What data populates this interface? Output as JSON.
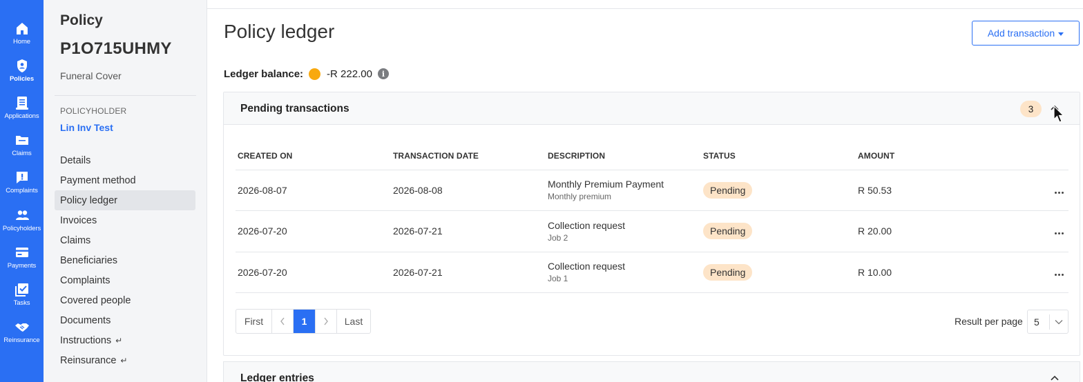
{
  "rail": [
    {
      "label": "Home",
      "icon": "home-icon"
    },
    {
      "label": "Policies",
      "icon": "shield-icon",
      "active": true
    },
    {
      "label": "Applications",
      "icon": "document-icon"
    },
    {
      "label": "Claims",
      "icon": "folder-icon"
    },
    {
      "label": "Complaints",
      "icon": "alert-message-icon"
    },
    {
      "label": "Policyholders",
      "icon": "people-icon"
    },
    {
      "label": "Payments",
      "icon": "credit-card-icon"
    },
    {
      "label": "Tasks",
      "icon": "task-check-icon"
    },
    {
      "label": "Reinsurance",
      "icon": "handshake-icon"
    }
  ],
  "policy": {
    "kicker": "Policy",
    "number": "P1O715UHMY",
    "product": "Funeral Cover",
    "policyholder_label": "POLICYHOLDER",
    "policyholder_name": "Lin Inv Test"
  },
  "nav": [
    {
      "label": "Details"
    },
    {
      "label": "Payment method"
    },
    {
      "label": "Policy ledger",
      "active": true
    },
    {
      "label": "Invoices"
    },
    {
      "label": "Claims"
    },
    {
      "label": "Beneficiaries"
    },
    {
      "label": "Complaints"
    },
    {
      "label": "Covered people"
    },
    {
      "label": "Documents"
    },
    {
      "label": "Instructions",
      "return_glyph": "↵"
    },
    {
      "label": "Reinsurance",
      "return_glyph": "↵"
    }
  ],
  "main": {
    "title": "Policy ledger",
    "add_button": "Add transaction",
    "balance_label": "Ledger balance:",
    "balance_value": "-R 222.00",
    "balance_status_color": "#f8a90f",
    "info_glyph": "i"
  },
  "pending": {
    "title": "Pending transactions",
    "count": "3",
    "columns": [
      "CREATED ON",
      "TRANSACTION DATE",
      "DESCRIPTION",
      "STATUS",
      "AMOUNT"
    ],
    "rows": [
      {
        "created": "2026-08-07",
        "tx_date": "2026-08-08",
        "desc": "Monthly Premium Payment",
        "sub": "Monthly premium",
        "status": "Pending",
        "amount": "R 50.53"
      },
      {
        "created": "2026-07-20",
        "tx_date": "2026-07-21",
        "desc": "Collection request",
        "sub": "Job 2",
        "status": "Pending",
        "amount": "R 20.00"
      },
      {
        "created": "2026-07-20",
        "tx_date": "2026-07-21",
        "desc": "Collection request",
        "sub": "Job 1",
        "status": "Pending",
        "amount": "R 10.00"
      }
    ],
    "pager": {
      "first": "First",
      "current": "1",
      "last": "Last"
    },
    "rpp_label": "Result per page",
    "rpp_value": "5"
  },
  "ledger_entries": {
    "title": "Ledger entries"
  },
  "colors": {
    "brand": "#2a6ff3",
    "pending_bg": "#fde4c8"
  }
}
